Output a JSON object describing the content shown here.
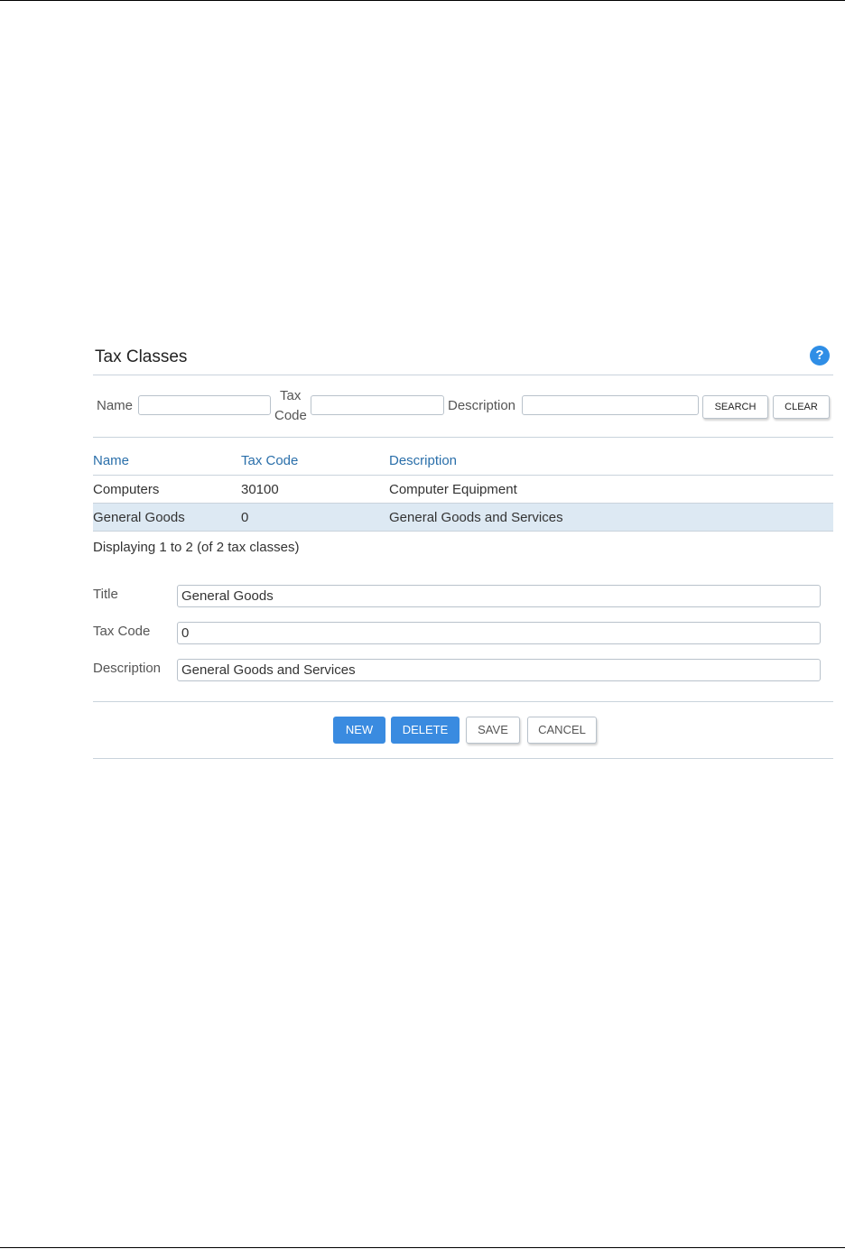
{
  "panel": {
    "title": "Tax Classes",
    "help_icon": "?"
  },
  "search": {
    "name_label": "Name",
    "tax_code_label_line1": "Tax",
    "tax_code_label_line2": "Code",
    "description_label": "Description",
    "name_value": "",
    "tax_code_value": "",
    "description_value": "",
    "search_button": "SEARCH",
    "clear_button": "CLEAR"
  },
  "table": {
    "headers": [
      "Name",
      "Tax Code",
      "Description"
    ],
    "rows": [
      {
        "name": "Computers",
        "tax_code": "30100",
        "description": "Computer Equipment"
      },
      {
        "name": "General Goods",
        "tax_code": "0",
        "description": "General Goods and Services"
      }
    ],
    "selected_row": 1
  },
  "display_count": "Displaying 1 to 2 (of 2 tax classes)",
  "form": {
    "title_label": "Title",
    "title_value": "General Goods",
    "tax_code_label": "Tax Code",
    "tax_code_value": "0",
    "description_label": "Description",
    "description_value": "General Goods and Services"
  },
  "actions": {
    "new": "NEW",
    "delete": "DELETE",
    "save": "SAVE",
    "cancel": "CANCEL"
  },
  "colors": {
    "accent": "#3a8be0",
    "link": "#2a6faa",
    "selected_row": "#dde9f3"
  }
}
